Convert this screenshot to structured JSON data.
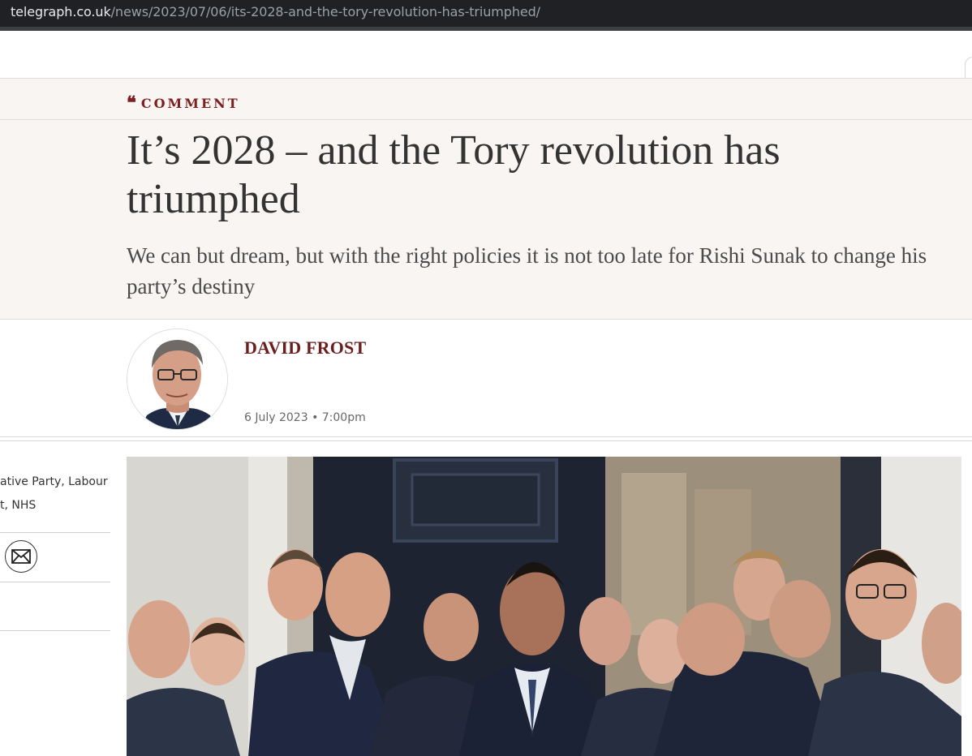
{
  "browser": {
    "url_domain": "telegraph.co.uk",
    "url_path": "/news/2023/07/06/its-2028-and-the-tory-revolution-has-triumphed/"
  },
  "article": {
    "section": "COMMENT",
    "section_icon": "quote-icon",
    "headline": "It’s 2028 – and the Tory revolution has triumphed",
    "standfirst": "We can but dream, but with the right policies it is not too late for Rishi Sunak to change his party’s destiny",
    "author": "DAVID FROST",
    "date": "6 July 2023 • 7:00pm"
  },
  "sidebar": {
    "tags_line1": "ative Party, Labour",
    "tags_line2": "t, NHS",
    "share_icon": "mail-icon"
  },
  "colors": {
    "accent": "#7d1f1f",
    "header_bg": "#f8f5f2",
    "text": "#333333"
  }
}
